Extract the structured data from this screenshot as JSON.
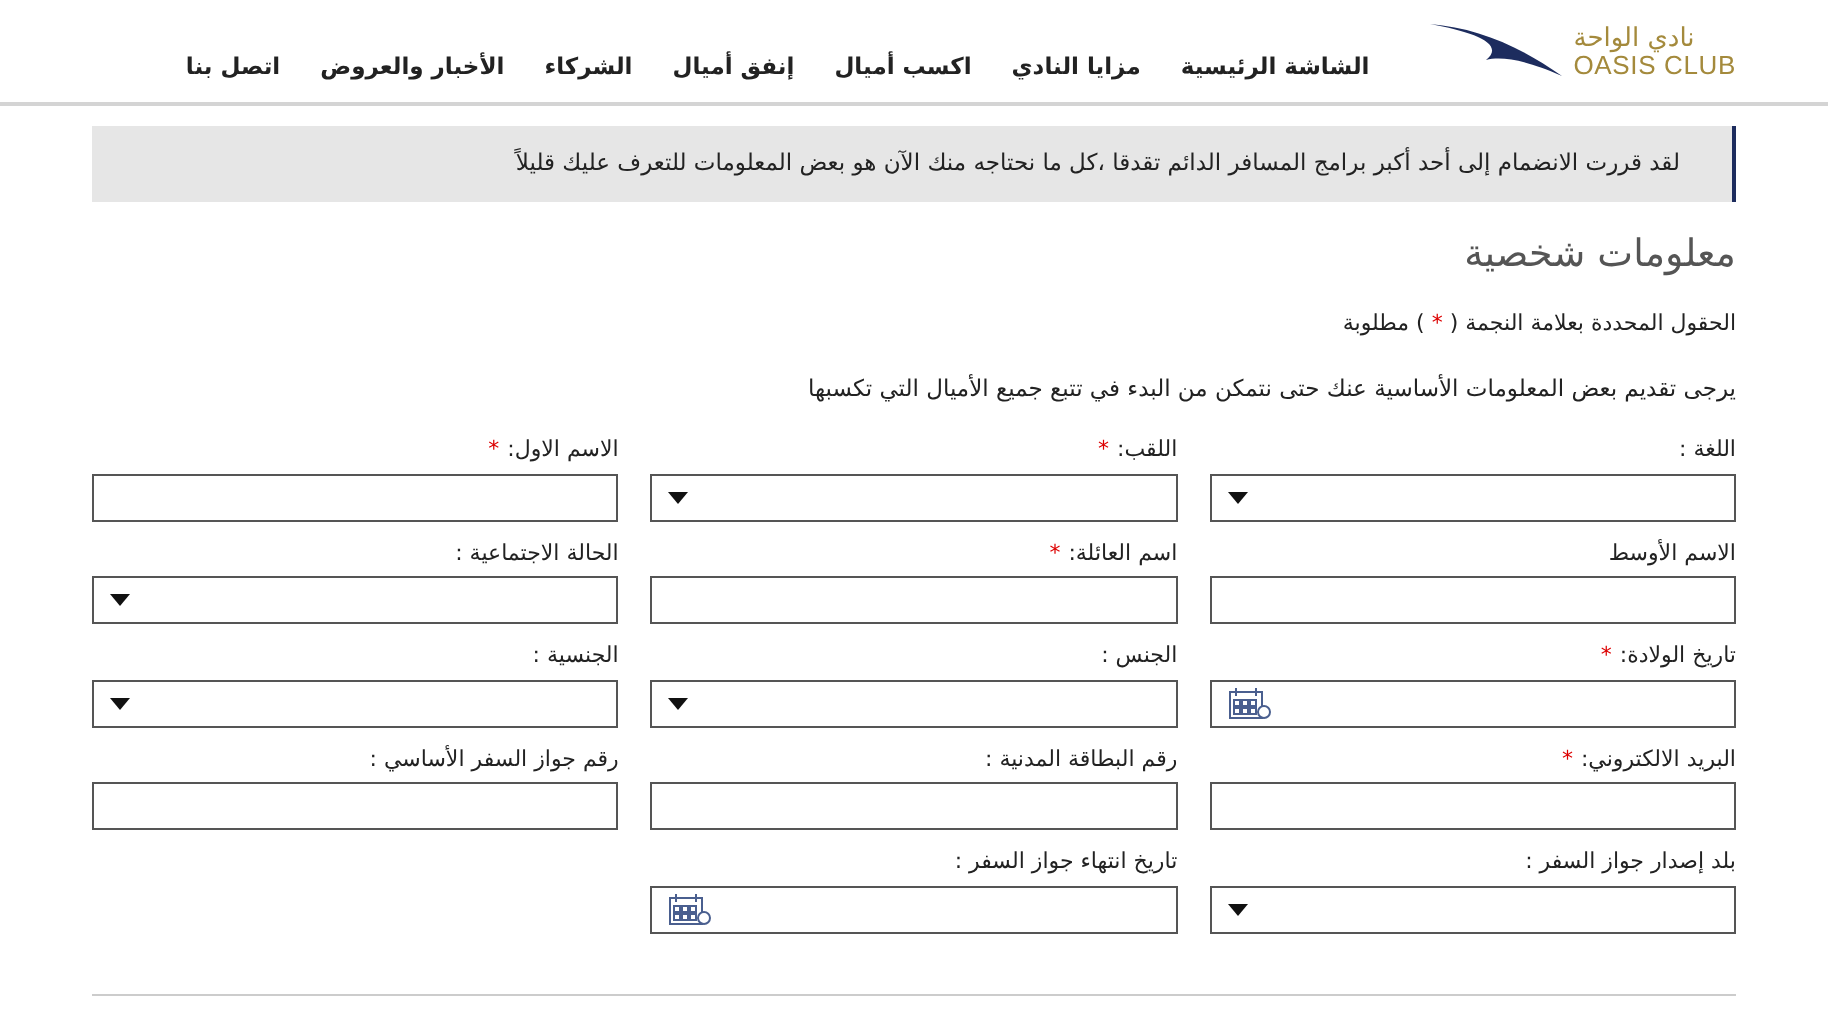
{
  "logo": {
    "arabic": "نادي الواحة",
    "english": "OASIS CLUB"
  },
  "nav": [
    "الشاشة الرئيسية",
    "مزايا النادي",
    "اكسب أميال",
    "إنفق أميال",
    "الشركاء",
    "الأخبار والعروض",
    "اتصل بنا"
  ],
  "notice": "لقد قررت الانضمام إلى أحد أكبر برامج المسافر الدائم تقدقا ،كل ما نحتاجه منك الآن هو بعض المعلومات للتعرف عليك قليلاً",
  "heading": "معلومات شخصية",
  "required_note": {
    "before": "الحقول المحددة بعلامة النجمة (",
    "mark": "*",
    "after": ") مطلوبة"
  },
  "intro": "يرجى تقديم بعض المعلومات الأساسية عنك حتى نتمكن من البدء في تتبع جميع الأميال التي تكسبها",
  "fields": [
    {
      "label": "اللغة :",
      "kind": "select"
    },
    {
      "label": "اللقب:",
      "kind": "select",
      "mark": "*"
    },
    {
      "label": "الاسم الاول:",
      "kind": "text",
      "mark": "*"
    },
    {
      "label": "الاسم الأوسط",
      "kind": "text"
    },
    {
      "label": "اسم العائلة:",
      "kind": "text",
      "mark": "*"
    },
    {
      "label": "الحالة الاجتماعية :",
      "kind": "select"
    },
    {
      "label": "تاريخ الولادة:",
      "kind": "date",
      "mark": "*"
    },
    {
      "label": "الجنس :",
      "kind": "select"
    },
    {
      "label": "الجنسية :",
      "kind": "select"
    },
    {
      "label": "البريد الالكتروني:",
      "kind": "text",
      "mark": "*"
    },
    {
      "label": "رقم البطاقة المدنية :",
      "kind": "text"
    },
    {
      "label": "رقم جواز السفر الأساسي :",
      "kind": "text"
    },
    {
      "label": "بلد إصدار جواز السفر :",
      "kind": "select"
    },
    {
      "label": "تاريخ انتهاء جواز السفر :",
      "kind": "date"
    }
  ]
}
